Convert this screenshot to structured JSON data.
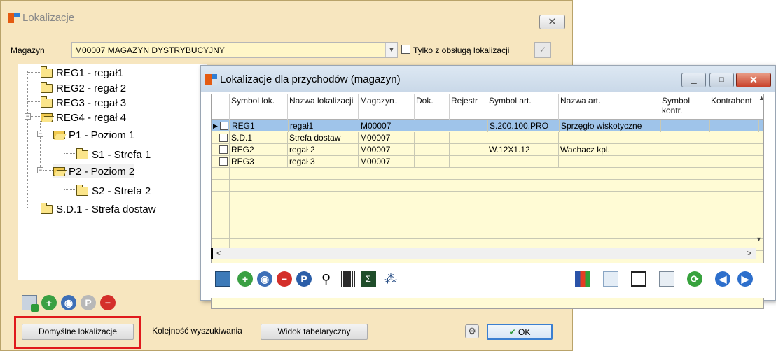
{
  "main_window": {
    "title": "Lokalizacje",
    "close_symbol": "✕",
    "magazyn_label": "Magazyn",
    "magazyn_value": "M00007 MAGAZYN DYSTRYBUCYJNY",
    "only_with_locations_label": "Tylko z obsługą lokalizacji",
    "only_with_locations_checked": false
  },
  "tree": {
    "items": [
      {
        "label": "REG1 - regał1"
      },
      {
        "label": "REG2 - regał 2"
      },
      {
        "label": "REG3 - regał 3"
      },
      {
        "label": "REG4 - regał 4"
      },
      {
        "label": "P1 - Poziom 1"
      },
      {
        "label": "S1 - Strefa 1"
      },
      {
        "label": "P2 - Poziom 2"
      },
      {
        "label": "S2 - Strefa 2"
      },
      {
        "label": "S.D.1 - Strefa dostaw"
      }
    ],
    "expander_minus": "−"
  },
  "bottom_buttons": {
    "default_locations": "Domyślne lokalizacje",
    "search_order": "Kolejność wyszukiwania",
    "table_view": "Widok tabelaryczny",
    "ok": "OK"
  },
  "sub_window": {
    "title": "Lokalizacje dla przychodów (magazyn)",
    "columns": [
      "Symbol lok.",
      "Nazwa lokalizacji",
      "Magazyn",
      "Dok.",
      "Rejestr",
      "Symbol art.",
      "Nazwa art.",
      "Symbol kontr.",
      "Kontrahent"
    ],
    "rows": [
      [
        "REG1",
        "regał1",
        "M00007",
        "",
        "",
        "S.200.100.PRO",
        "Sprzęgło wiskotyczne",
        "",
        ""
      ],
      [
        "S.D.1",
        "Strefa dostaw",
        "M00007",
        "",
        "",
        "",
        "",
        "",
        ""
      ],
      [
        "REG2",
        "regał 2",
        "M00007",
        "",
        "",
        "W.12X1.12",
        "Wachacz kpl.",
        "",
        ""
      ],
      [
        "REG3",
        "regał 3",
        "M00007",
        "",
        "",
        "",
        "",
        "",
        ""
      ]
    ],
    "selected_row": 0
  },
  "icons": {
    "main_toolbar": [
      "grid-add-icon",
      "add-icon",
      "search-icon",
      "park-icon",
      "remove-icon"
    ],
    "sub_toolbar": [
      "import-icon",
      "add-icon",
      "search-icon",
      "remove-icon",
      "park-icon",
      "binoculars-icon",
      "barcode-icon",
      "sigma-icon",
      "tree-icon",
      "chart-icon",
      "report-icon",
      "save-icon",
      "copy-icon",
      "refresh-icon",
      "prev-icon",
      "next-icon"
    ]
  },
  "colors": {
    "main_bg": "#f7e6bf",
    "grid_bg": "#fffbd5",
    "selection": "#9fc4ea",
    "highlight_box": "#e0191c"
  }
}
